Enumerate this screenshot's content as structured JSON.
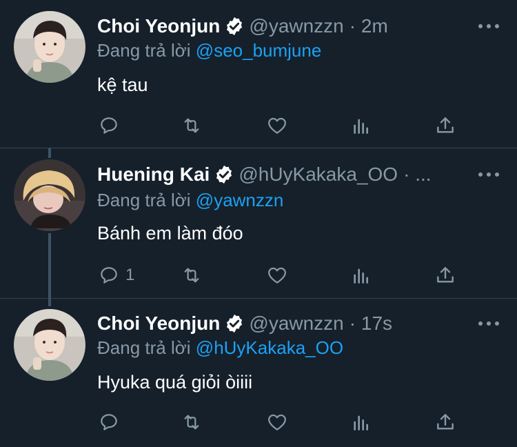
{
  "colors": {
    "background": "#15202b",
    "secondary_text": "#8899a6",
    "mention": "#1da1f2",
    "separator": "#38444d",
    "thread_line": "#3d5466"
  },
  "tweets": [
    {
      "name": "Choi Yeonjun",
      "handle": "@yawnzzn",
      "time": "· 2m",
      "reply_prefix": "Đang trả lời",
      "reply_to": "@seo_bumjune",
      "text": "kệ tau",
      "reply_count": "",
      "avatar_icon": "profile-photo"
    },
    {
      "name": "Huening Kai",
      "handle": "@hUyKakaka_OO",
      "time": "· ...",
      "reply_prefix": "Đang trả lời",
      "reply_to": "@yawnzzn",
      "text": "Bánh em làm đóo",
      "reply_count": "1",
      "avatar_icon": "profile-photo"
    },
    {
      "name": "Choi Yeonjun",
      "handle": "@yawnzzn",
      "time": "· 17s",
      "reply_prefix": "Đang trả lời",
      "reply_to": "@hUyKakaka_OO",
      "text": "Hyuka quá giỏi òiiii",
      "reply_count": "",
      "avatar_icon": "profile-photo"
    }
  ],
  "action_icons": [
    "reply-icon",
    "retweet-icon",
    "like-icon",
    "analytics-icon",
    "share-icon"
  ]
}
